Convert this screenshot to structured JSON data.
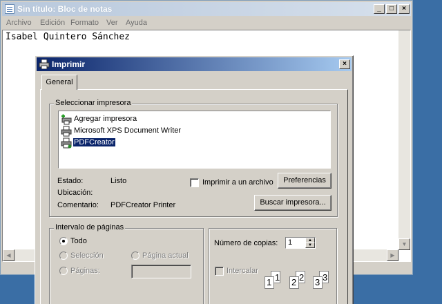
{
  "notepad": {
    "title": "Sin título: Bloc de notas",
    "menu": [
      "Archivo",
      "Edición",
      "Formato",
      "Ver",
      "Ayuda"
    ],
    "content": "Isabel Quintero Sánchez"
  },
  "dialog": {
    "title": "Imprimir",
    "tab": "General",
    "select_printer": {
      "legend": "Seleccionar impresora",
      "printers": [
        {
          "name": "Agregar impresora",
          "icon": "add-printer-icon"
        },
        {
          "name": "Microsoft XPS Document Writer",
          "icon": "printer-icon"
        },
        {
          "name": "PDFCreator",
          "icon": "printer-icon",
          "selected": true
        }
      ],
      "status_label": "Estado:",
      "status_value": "Listo",
      "location_label": "Ubicación:",
      "location_value": "",
      "comment_label": "Comentario:",
      "comment_value": "PDFCreator Printer",
      "print_to_file_label": "Imprimir a un archivo",
      "preferences_button": "Preferencias",
      "find_printer_button": "Buscar impresora..."
    },
    "page_range": {
      "legend": "Intervalo de páginas",
      "all": "Todo",
      "selection": "Selección",
      "current_page": "Página actual",
      "pages": "Páginas:"
    },
    "copies": {
      "label": "Número de copias:",
      "value": "1",
      "collate_label": "Intercalar",
      "collate_pages": [
        "1",
        "1",
        "2",
        "2",
        "3",
        "3"
      ]
    }
  }
}
